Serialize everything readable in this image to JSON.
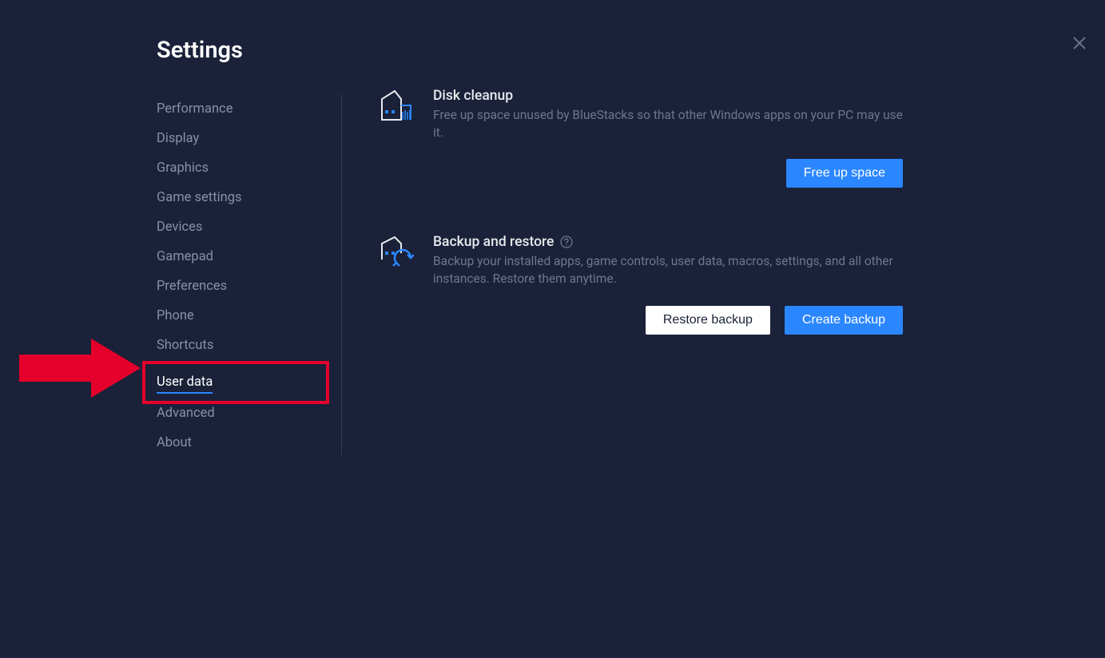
{
  "page_title": "Settings",
  "sidebar": {
    "items": [
      {
        "label": "Performance",
        "active": false
      },
      {
        "label": "Display",
        "active": false
      },
      {
        "label": "Graphics",
        "active": false
      },
      {
        "label": "Game settings",
        "active": false
      },
      {
        "label": "Devices",
        "active": false
      },
      {
        "label": "Gamepad",
        "active": false
      },
      {
        "label": "Preferences",
        "active": false
      },
      {
        "label": "Phone",
        "active": false
      },
      {
        "label": "Shortcuts",
        "active": false
      },
      {
        "label": "User data",
        "active": true
      },
      {
        "label": "Advanced",
        "active": false
      },
      {
        "label": "About",
        "active": false
      }
    ]
  },
  "content": {
    "disk_cleanup": {
      "title": "Disk cleanup",
      "description": "Free up space unused by BlueStacks so that other Windows apps on your PC may use it.",
      "button": "Free up space"
    },
    "backup_restore": {
      "title": "Backup and restore",
      "description": "Backup your installed apps, game controls, user data, macros, settings, and all other instances. Restore them anytime.",
      "restore_button": "Restore backup",
      "create_button": "Create backup"
    }
  },
  "annotation": {
    "color": "#e4002b",
    "target": "User data"
  }
}
